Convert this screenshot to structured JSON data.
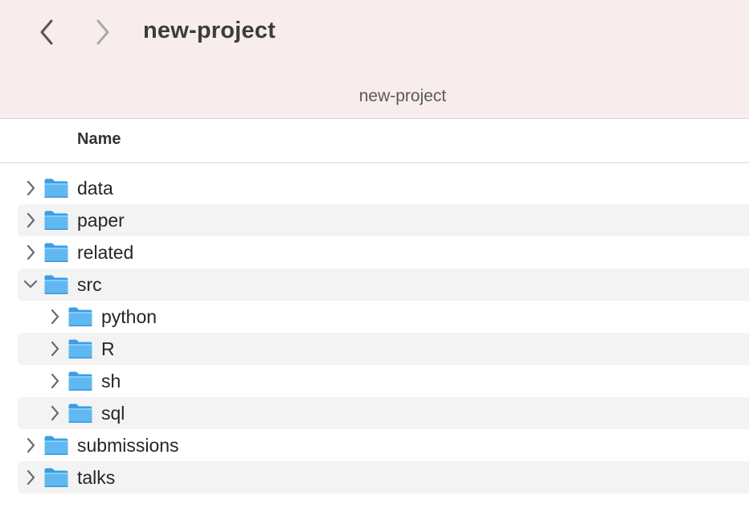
{
  "window": {
    "title": "new-project",
    "path_label": "new-project",
    "back_icon": "chevron-left-icon",
    "forward_icon": "chevron-right-icon"
  },
  "columns": {
    "name_header": "Name"
  },
  "colors": {
    "titlebar_bg": "#f8eced",
    "folder_blue": "#5fb8f2",
    "row_alt": "#f3f3f3"
  },
  "items": [
    {
      "label": "data",
      "level": 0,
      "expanded": false,
      "icon": "folder-icon"
    },
    {
      "label": "paper",
      "level": 0,
      "expanded": false,
      "icon": "folder-icon"
    },
    {
      "label": "related",
      "level": 0,
      "expanded": false,
      "icon": "folder-icon"
    },
    {
      "label": "src",
      "level": 0,
      "expanded": true,
      "icon": "folder-icon"
    },
    {
      "label": "python",
      "level": 1,
      "expanded": false,
      "icon": "folder-icon"
    },
    {
      "label": "R",
      "level": 1,
      "expanded": false,
      "icon": "folder-icon"
    },
    {
      "label": "sh",
      "level": 1,
      "expanded": false,
      "icon": "folder-icon"
    },
    {
      "label": "sql",
      "level": 1,
      "expanded": false,
      "icon": "folder-icon"
    },
    {
      "label": "submissions",
      "level": 0,
      "expanded": false,
      "icon": "folder-icon"
    },
    {
      "label": "talks",
      "level": 0,
      "expanded": false,
      "icon": "folder-icon"
    }
  ]
}
